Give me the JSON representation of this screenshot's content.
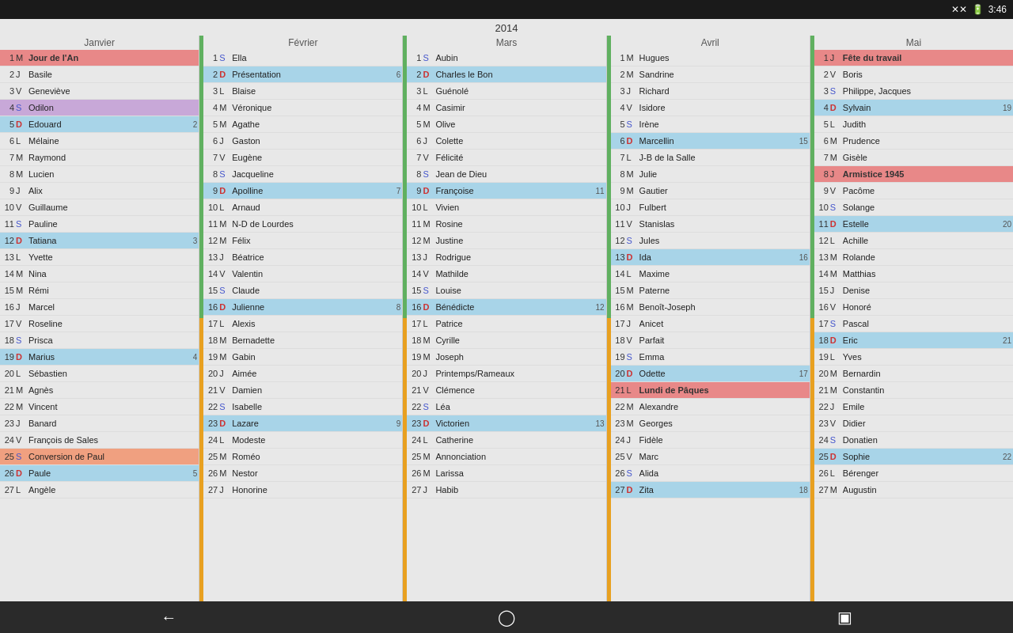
{
  "statusBar": {
    "signal": "✕✕",
    "battery": "▮",
    "time": "3:46"
  },
  "year": "2014",
  "nav": {
    "back": "←",
    "home": "⬜",
    "recent": "▣"
  },
  "months": [
    {
      "name": "Janvier",
      "days": [
        {
          "n": 1,
          "l": "M",
          "name": "Jour de l'An",
          "hl": "row-red row-bold",
          "count": ""
        },
        {
          "n": 2,
          "l": "J",
          "name": "Basile",
          "hl": "",
          "count": ""
        },
        {
          "n": 3,
          "l": "V",
          "name": "Geneviève",
          "hl": "",
          "count": ""
        },
        {
          "n": 4,
          "l": "S",
          "name": "Odilon",
          "hl": "row-purple",
          "count": ""
        },
        {
          "n": 5,
          "l": "D",
          "name": "Edouard",
          "hl": "row-blue",
          "count": "2"
        },
        {
          "n": 6,
          "l": "L",
          "name": "Mélaine",
          "hl": "",
          "count": ""
        },
        {
          "n": 7,
          "l": "M",
          "name": "Raymond",
          "hl": "",
          "count": ""
        },
        {
          "n": 8,
          "l": "M",
          "name": "Lucien",
          "hl": "",
          "count": ""
        },
        {
          "n": 9,
          "l": "J",
          "name": "Alix",
          "hl": "",
          "count": ""
        },
        {
          "n": 10,
          "l": "V",
          "name": "Guillaume",
          "hl": "",
          "count": ""
        },
        {
          "n": 11,
          "l": "S",
          "name": "Pauline",
          "hl": "",
          "count": ""
        },
        {
          "n": 12,
          "l": "D",
          "name": "Tatiana",
          "hl": "row-blue",
          "count": "3"
        },
        {
          "n": 13,
          "l": "L",
          "name": "Yvette",
          "hl": "",
          "count": ""
        },
        {
          "n": 14,
          "l": "M",
          "name": "Nina",
          "hl": "",
          "count": ""
        },
        {
          "n": 15,
          "l": "M",
          "name": "Rémi",
          "hl": "",
          "count": ""
        },
        {
          "n": 16,
          "l": "J",
          "name": "Marcel",
          "hl": "",
          "count": ""
        },
        {
          "n": 17,
          "l": "V",
          "name": "Roseline",
          "hl": "",
          "count": ""
        },
        {
          "n": 18,
          "l": "S",
          "name": "Prisca",
          "hl": "",
          "count": ""
        },
        {
          "n": 19,
          "l": "D",
          "name": "Marius",
          "hl": "row-blue",
          "count": "4"
        },
        {
          "n": 20,
          "l": "L",
          "name": "Sébastien",
          "hl": "",
          "count": ""
        },
        {
          "n": 21,
          "l": "M",
          "name": "Agnès",
          "hl": "",
          "count": ""
        },
        {
          "n": 22,
          "l": "M",
          "name": "Vincent",
          "hl": "",
          "count": ""
        },
        {
          "n": 23,
          "l": "J",
          "name": "Banard",
          "hl": "",
          "count": ""
        },
        {
          "n": 24,
          "l": "V",
          "name": "François de Sales",
          "hl": "",
          "count": ""
        },
        {
          "n": 25,
          "l": "S",
          "name": "Conversion de Paul",
          "hl": "row-peach",
          "count": ""
        },
        {
          "n": 26,
          "l": "D",
          "name": "Paule",
          "hl": "row-blue",
          "count": "5"
        },
        {
          "n": 27,
          "l": "L",
          "name": "Angèle",
          "hl": "",
          "count": ""
        }
      ]
    },
    {
      "name": "Février",
      "days": [
        {
          "n": 1,
          "l": "S",
          "name": "Ella",
          "hl": "",
          "count": ""
        },
        {
          "n": 2,
          "l": "D",
          "name": "Présentation",
          "hl": "row-blue",
          "count": "6"
        },
        {
          "n": 3,
          "l": "L",
          "name": "Blaise",
          "hl": "",
          "count": ""
        },
        {
          "n": 4,
          "l": "M",
          "name": "Véronique",
          "hl": "",
          "count": ""
        },
        {
          "n": 5,
          "l": "M",
          "name": "Agathe",
          "hl": "",
          "count": ""
        },
        {
          "n": 6,
          "l": "J",
          "name": "Gaston",
          "hl": "",
          "count": ""
        },
        {
          "n": 7,
          "l": "V",
          "name": "Eugène",
          "hl": "",
          "count": ""
        },
        {
          "n": 8,
          "l": "S",
          "name": "Jacqueline",
          "hl": "",
          "count": ""
        },
        {
          "n": 9,
          "l": "D",
          "name": "Apolline",
          "hl": "row-blue",
          "count": "7"
        },
        {
          "n": 10,
          "l": "L",
          "name": "Arnaud",
          "hl": "",
          "count": ""
        },
        {
          "n": 11,
          "l": "M",
          "name": "N-D de Lourdes",
          "hl": "",
          "count": ""
        },
        {
          "n": 12,
          "l": "M",
          "name": "Félix",
          "hl": "",
          "count": ""
        },
        {
          "n": 13,
          "l": "J",
          "name": "Béatrice",
          "hl": "",
          "count": ""
        },
        {
          "n": 14,
          "l": "V",
          "name": "Valentin",
          "hl": "",
          "count": ""
        },
        {
          "n": 15,
          "l": "S",
          "name": "Claude",
          "hl": "",
          "count": ""
        },
        {
          "n": 16,
          "l": "D",
          "name": "Julienne",
          "hl": "row-blue",
          "count": "8"
        },
        {
          "n": 17,
          "l": "L",
          "name": "Alexis",
          "hl": "",
          "count": ""
        },
        {
          "n": 18,
          "l": "M",
          "name": "Bernadette",
          "hl": "",
          "count": ""
        },
        {
          "n": 19,
          "l": "M",
          "name": "Gabin",
          "hl": "",
          "count": ""
        },
        {
          "n": 20,
          "l": "J",
          "name": "Aimée",
          "hl": "",
          "count": ""
        },
        {
          "n": 21,
          "l": "V",
          "name": "Damien",
          "hl": "",
          "count": ""
        },
        {
          "n": 22,
          "l": "S",
          "name": "Isabelle",
          "hl": "",
          "count": ""
        },
        {
          "n": 23,
          "l": "D",
          "name": "Lazare",
          "hl": "row-blue",
          "count": "9"
        },
        {
          "n": 24,
          "l": "L",
          "name": "Modeste",
          "hl": "",
          "count": ""
        },
        {
          "n": 25,
          "l": "M",
          "name": "Roméo",
          "hl": "",
          "count": ""
        },
        {
          "n": 26,
          "l": "M",
          "name": "Nestor",
          "hl": "",
          "count": ""
        },
        {
          "n": 27,
          "l": "J",
          "name": "Honorine",
          "hl": "",
          "count": ""
        }
      ]
    },
    {
      "name": "Mars",
      "days": [
        {
          "n": 1,
          "l": "S",
          "name": "Aubin",
          "hl": "",
          "count": ""
        },
        {
          "n": 2,
          "l": "D",
          "name": "Charles le Bon",
          "hl": "row-blue",
          "count": ""
        },
        {
          "n": 3,
          "l": "L",
          "name": "Guénolé",
          "hl": "",
          "count": ""
        },
        {
          "n": 4,
          "l": "M",
          "name": "Casimir",
          "hl": "",
          "count": ""
        },
        {
          "n": 5,
          "l": "M",
          "name": "Olive",
          "hl": "",
          "count": ""
        },
        {
          "n": 6,
          "l": "J",
          "name": "Colette",
          "hl": "",
          "count": ""
        },
        {
          "n": 7,
          "l": "V",
          "name": "Félicité",
          "hl": "",
          "count": ""
        },
        {
          "n": 8,
          "l": "S",
          "name": "Jean de Dieu",
          "hl": "",
          "count": ""
        },
        {
          "n": 9,
          "l": "D",
          "name": "Françoise",
          "hl": "row-blue",
          "count": "11"
        },
        {
          "n": 10,
          "l": "L",
          "name": "Vivien",
          "hl": "",
          "count": ""
        },
        {
          "n": 11,
          "l": "M",
          "name": "Rosine",
          "hl": "",
          "count": ""
        },
        {
          "n": 12,
          "l": "M",
          "name": "Justine",
          "hl": "",
          "count": ""
        },
        {
          "n": 13,
          "l": "J",
          "name": "Rodrigue",
          "hl": "",
          "count": ""
        },
        {
          "n": 14,
          "l": "V",
          "name": "Mathilde",
          "hl": "",
          "count": ""
        },
        {
          "n": 15,
          "l": "S",
          "name": "Louise",
          "hl": "",
          "count": ""
        },
        {
          "n": 16,
          "l": "D",
          "name": "Bénédicte",
          "hl": "row-blue",
          "count": "12"
        },
        {
          "n": 17,
          "l": "L",
          "name": "Patrice",
          "hl": "",
          "count": ""
        },
        {
          "n": 18,
          "l": "M",
          "name": "Cyrille",
          "hl": "",
          "count": ""
        },
        {
          "n": 19,
          "l": "M",
          "name": "Joseph",
          "hl": "",
          "count": ""
        },
        {
          "n": 20,
          "l": "J",
          "name": "Printemps/Rameaux",
          "hl": "",
          "count": ""
        },
        {
          "n": 21,
          "l": "V",
          "name": "Clémence",
          "hl": "",
          "count": ""
        },
        {
          "n": 22,
          "l": "S",
          "name": "Léa",
          "hl": "",
          "count": ""
        },
        {
          "n": 23,
          "l": "D",
          "name": "Victorien",
          "hl": "row-blue",
          "count": "13"
        },
        {
          "n": 24,
          "l": "L",
          "name": "Catherine",
          "hl": "",
          "count": ""
        },
        {
          "n": 25,
          "l": "M",
          "name": "Annonciation",
          "hl": "",
          "count": ""
        },
        {
          "n": 26,
          "l": "M",
          "name": "Larissa",
          "hl": "",
          "count": ""
        },
        {
          "n": 27,
          "l": "J",
          "name": "Habib",
          "hl": "",
          "count": ""
        }
      ]
    },
    {
      "name": "Avril",
      "days": [
        {
          "n": 1,
          "l": "M",
          "name": "Hugues",
          "hl": "",
          "count": ""
        },
        {
          "n": 2,
          "l": "M",
          "name": "Sandrine",
          "hl": "",
          "count": ""
        },
        {
          "n": 3,
          "l": "J",
          "name": "Richard",
          "hl": "",
          "count": ""
        },
        {
          "n": 4,
          "l": "V",
          "name": "Isidore",
          "hl": "",
          "count": ""
        },
        {
          "n": 5,
          "l": "S",
          "name": "Irène",
          "hl": "",
          "count": ""
        },
        {
          "n": 6,
          "l": "D",
          "name": "Marcellin",
          "hl": "row-blue",
          "count": "15"
        },
        {
          "n": 7,
          "l": "L",
          "name": "J-B de la Salle",
          "hl": "",
          "count": ""
        },
        {
          "n": 8,
          "l": "M",
          "name": "Julie",
          "hl": "",
          "count": ""
        },
        {
          "n": 9,
          "l": "M",
          "name": "Gautier",
          "hl": "",
          "count": ""
        },
        {
          "n": 10,
          "l": "J",
          "name": "Fulbert",
          "hl": "",
          "count": ""
        },
        {
          "n": 11,
          "l": "V",
          "name": "Stanislas",
          "hl": "",
          "count": ""
        },
        {
          "n": 12,
          "l": "S",
          "name": "Jules",
          "hl": "",
          "count": ""
        },
        {
          "n": 13,
          "l": "D",
          "name": "Ida",
          "hl": "row-blue",
          "count": "16"
        },
        {
          "n": 14,
          "l": "L",
          "name": "Maxime",
          "hl": "",
          "count": ""
        },
        {
          "n": 15,
          "l": "M",
          "name": "Paterne",
          "hl": "",
          "count": ""
        },
        {
          "n": 16,
          "l": "M",
          "name": "Benoît-Joseph",
          "hl": "",
          "count": ""
        },
        {
          "n": 17,
          "l": "J",
          "name": "Anicet",
          "hl": "",
          "count": ""
        },
        {
          "n": 18,
          "l": "V",
          "name": "Parfait",
          "hl": "",
          "count": ""
        },
        {
          "n": 19,
          "l": "S",
          "name": "Emma",
          "hl": "",
          "count": ""
        },
        {
          "n": 20,
          "l": "D",
          "name": "Odette",
          "hl": "row-blue",
          "count": "17"
        },
        {
          "n": 21,
          "l": "L",
          "name": "Lundi de Pâques",
          "hl": "row-red row-bold",
          "count": ""
        },
        {
          "n": 22,
          "l": "M",
          "name": "Alexandre",
          "hl": "",
          "count": ""
        },
        {
          "n": 23,
          "l": "M",
          "name": "Georges",
          "hl": "",
          "count": ""
        },
        {
          "n": 24,
          "l": "J",
          "name": "Fidèle",
          "hl": "",
          "count": ""
        },
        {
          "n": 25,
          "l": "V",
          "name": "Marc",
          "hl": "",
          "count": ""
        },
        {
          "n": 26,
          "l": "S",
          "name": "Alida",
          "hl": "",
          "count": ""
        },
        {
          "n": 27,
          "l": "D",
          "name": "Zita",
          "hl": "row-blue",
          "count": "18"
        }
      ]
    },
    {
      "name": "Mai",
      "days": [
        {
          "n": 1,
          "l": "J",
          "name": "Fête du travail",
          "hl": "row-red row-bold",
          "count": ""
        },
        {
          "n": 2,
          "l": "V",
          "name": "Boris",
          "hl": "",
          "count": ""
        },
        {
          "n": 3,
          "l": "S",
          "name": "Philippe, Jacques",
          "hl": "",
          "count": ""
        },
        {
          "n": 4,
          "l": "D",
          "name": "Sylvain",
          "hl": "row-blue",
          "count": "19"
        },
        {
          "n": 5,
          "l": "L",
          "name": "Judith",
          "hl": "",
          "count": ""
        },
        {
          "n": 6,
          "l": "M",
          "name": "Prudence",
          "hl": "",
          "count": ""
        },
        {
          "n": 7,
          "l": "M",
          "name": "Gisèle",
          "hl": "",
          "count": ""
        },
        {
          "n": 8,
          "l": "J",
          "name": "Armistice 1945",
          "hl": "row-red row-bold",
          "count": ""
        },
        {
          "n": 9,
          "l": "V",
          "name": "Pacôme",
          "hl": "",
          "count": ""
        },
        {
          "n": 10,
          "l": "S",
          "name": "Solange",
          "hl": "",
          "count": ""
        },
        {
          "n": 11,
          "l": "D",
          "name": "Estelle",
          "hl": "row-blue",
          "count": "20"
        },
        {
          "n": 12,
          "l": "L",
          "name": "Achille",
          "hl": "",
          "count": ""
        },
        {
          "n": 13,
          "l": "M",
          "name": "Rolande",
          "hl": "",
          "count": ""
        },
        {
          "n": 14,
          "l": "M",
          "name": "Matthias",
          "hl": "",
          "count": ""
        },
        {
          "n": 15,
          "l": "J",
          "name": "Denise",
          "hl": "",
          "count": ""
        },
        {
          "n": 16,
          "l": "V",
          "name": "Honoré",
          "hl": "",
          "count": ""
        },
        {
          "n": 17,
          "l": "S",
          "name": "Pascal",
          "hl": "",
          "count": ""
        },
        {
          "n": 18,
          "l": "D",
          "name": "Eric",
          "hl": "row-blue",
          "count": "21"
        },
        {
          "n": 19,
          "l": "L",
          "name": "Yves",
          "hl": "",
          "count": ""
        },
        {
          "n": 20,
          "l": "M",
          "name": "Bernardin",
          "hl": "",
          "count": ""
        },
        {
          "n": 21,
          "l": "M",
          "name": "Constantin",
          "hl": "",
          "count": ""
        },
        {
          "n": 22,
          "l": "J",
          "name": "Emile",
          "hl": "",
          "count": ""
        },
        {
          "n": 23,
          "l": "V",
          "name": "Didier",
          "hl": "",
          "count": ""
        },
        {
          "n": 24,
          "l": "S",
          "name": "Donatien",
          "hl": "",
          "count": ""
        },
        {
          "n": 25,
          "l": "D",
          "name": "Sophie",
          "hl": "row-blue",
          "count": "22"
        },
        {
          "n": 26,
          "l": "L",
          "name": "Bérenger",
          "hl": "",
          "count": ""
        },
        {
          "n": 27,
          "l": "M",
          "name": "Augustin",
          "hl": "",
          "count": ""
        }
      ]
    }
  ]
}
